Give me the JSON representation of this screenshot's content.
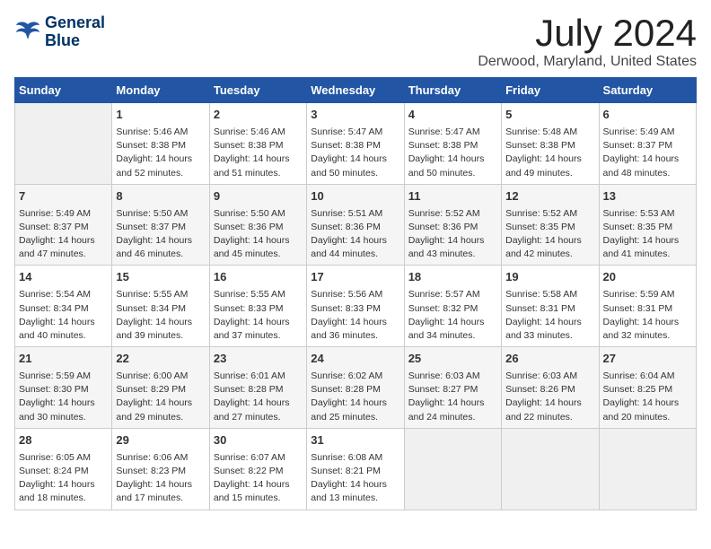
{
  "app": {
    "name": "GeneralBlue",
    "logo_line1": "General",
    "logo_line2": "Blue"
  },
  "calendar": {
    "month_year": "July 2024",
    "location": "Derwood, Maryland, United States",
    "days_of_week": [
      "Sunday",
      "Monday",
      "Tuesday",
      "Wednesday",
      "Thursday",
      "Friday",
      "Saturday"
    ],
    "weeks": [
      [
        {
          "day": "",
          "info": ""
        },
        {
          "day": "1",
          "info": "Sunrise: 5:46 AM\nSunset: 8:38 PM\nDaylight: 14 hours\nand 52 minutes."
        },
        {
          "day": "2",
          "info": "Sunrise: 5:46 AM\nSunset: 8:38 PM\nDaylight: 14 hours\nand 51 minutes."
        },
        {
          "day": "3",
          "info": "Sunrise: 5:47 AM\nSunset: 8:38 PM\nDaylight: 14 hours\nand 50 minutes."
        },
        {
          "day": "4",
          "info": "Sunrise: 5:47 AM\nSunset: 8:38 PM\nDaylight: 14 hours\nand 50 minutes."
        },
        {
          "day": "5",
          "info": "Sunrise: 5:48 AM\nSunset: 8:38 PM\nDaylight: 14 hours\nand 49 minutes."
        },
        {
          "day": "6",
          "info": "Sunrise: 5:49 AM\nSunset: 8:37 PM\nDaylight: 14 hours\nand 48 minutes."
        }
      ],
      [
        {
          "day": "7",
          "info": "Sunrise: 5:49 AM\nSunset: 8:37 PM\nDaylight: 14 hours\nand 47 minutes."
        },
        {
          "day": "8",
          "info": "Sunrise: 5:50 AM\nSunset: 8:37 PM\nDaylight: 14 hours\nand 46 minutes."
        },
        {
          "day": "9",
          "info": "Sunrise: 5:50 AM\nSunset: 8:36 PM\nDaylight: 14 hours\nand 45 minutes."
        },
        {
          "day": "10",
          "info": "Sunrise: 5:51 AM\nSunset: 8:36 PM\nDaylight: 14 hours\nand 44 minutes."
        },
        {
          "day": "11",
          "info": "Sunrise: 5:52 AM\nSunset: 8:36 PM\nDaylight: 14 hours\nand 43 minutes."
        },
        {
          "day": "12",
          "info": "Sunrise: 5:52 AM\nSunset: 8:35 PM\nDaylight: 14 hours\nand 42 minutes."
        },
        {
          "day": "13",
          "info": "Sunrise: 5:53 AM\nSunset: 8:35 PM\nDaylight: 14 hours\nand 41 minutes."
        }
      ],
      [
        {
          "day": "14",
          "info": "Sunrise: 5:54 AM\nSunset: 8:34 PM\nDaylight: 14 hours\nand 40 minutes."
        },
        {
          "day": "15",
          "info": "Sunrise: 5:55 AM\nSunset: 8:34 PM\nDaylight: 14 hours\nand 39 minutes."
        },
        {
          "day": "16",
          "info": "Sunrise: 5:55 AM\nSunset: 8:33 PM\nDaylight: 14 hours\nand 37 minutes."
        },
        {
          "day": "17",
          "info": "Sunrise: 5:56 AM\nSunset: 8:33 PM\nDaylight: 14 hours\nand 36 minutes."
        },
        {
          "day": "18",
          "info": "Sunrise: 5:57 AM\nSunset: 8:32 PM\nDaylight: 14 hours\nand 34 minutes."
        },
        {
          "day": "19",
          "info": "Sunrise: 5:58 AM\nSunset: 8:31 PM\nDaylight: 14 hours\nand 33 minutes."
        },
        {
          "day": "20",
          "info": "Sunrise: 5:59 AM\nSunset: 8:31 PM\nDaylight: 14 hours\nand 32 minutes."
        }
      ],
      [
        {
          "day": "21",
          "info": "Sunrise: 5:59 AM\nSunset: 8:30 PM\nDaylight: 14 hours\nand 30 minutes."
        },
        {
          "day": "22",
          "info": "Sunrise: 6:00 AM\nSunset: 8:29 PM\nDaylight: 14 hours\nand 29 minutes."
        },
        {
          "day": "23",
          "info": "Sunrise: 6:01 AM\nSunset: 8:28 PM\nDaylight: 14 hours\nand 27 minutes."
        },
        {
          "day": "24",
          "info": "Sunrise: 6:02 AM\nSunset: 8:28 PM\nDaylight: 14 hours\nand 25 minutes."
        },
        {
          "day": "25",
          "info": "Sunrise: 6:03 AM\nSunset: 8:27 PM\nDaylight: 14 hours\nand 24 minutes."
        },
        {
          "day": "26",
          "info": "Sunrise: 6:03 AM\nSunset: 8:26 PM\nDaylight: 14 hours\nand 22 minutes."
        },
        {
          "day": "27",
          "info": "Sunrise: 6:04 AM\nSunset: 8:25 PM\nDaylight: 14 hours\nand 20 minutes."
        }
      ],
      [
        {
          "day": "28",
          "info": "Sunrise: 6:05 AM\nSunset: 8:24 PM\nDaylight: 14 hours\nand 18 minutes."
        },
        {
          "day": "29",
          "info": "Sunrise: 6:06 AM\nSunset: 8:23 PM\nDaylight: 14 hours\nand 17 minutes."
        },
        {
          "day": "30",
          "info": "Sunrise: 6:07 AM\nSunset: 8:22 PM\nDaylight: 14 hours\nand 15 minutes."
        },
        {
          "day": "31",
          "info": "Sunrise: 6:08 AM\nSunset: 8:21 PM\nDaylight: 14 hours\nand 13 minutes."
        },
        {
          "day": "",
          "info": ""
        },
        {
          "day": "",
          "info": ""
        },
        {
          "day": "",
          "info": ""
        }
      ]
    ]
  }
}
